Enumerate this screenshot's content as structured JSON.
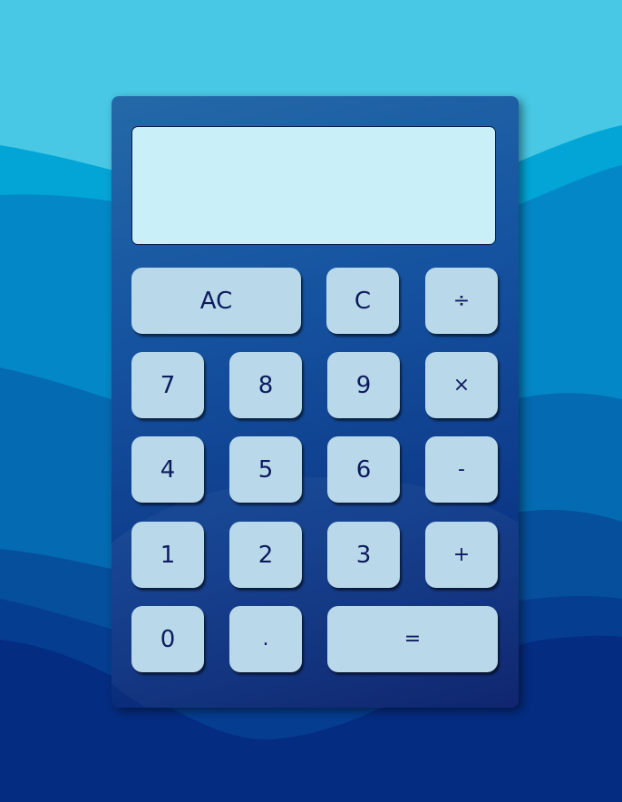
{
  "display": {
    "value": ""
  },
  "colors": {
    "key_bg": "#b9d9ea",
    "key_text": "#0d1b5e",
    "display_bg": "#c9f0f8",
    "body_top": "#2569a8",
    "body_bottom": "#071e6a"
  },
  "keys": {
    "ac": "AC",
    "clear": "C",
    "divide": "÷",
    "seven": "7",
    "eight": "8",
    "nine": "9",
    "multiply": "×",
    "four": "4",
    "five": "5",
    "six": "6",
    "subtract": "-",
    "one": "1",
    "two": "2",
    "three": "3",
    "add": "+",
    "zero": "0",
    "decimal": ".",
    "equals": "="
  }
}
